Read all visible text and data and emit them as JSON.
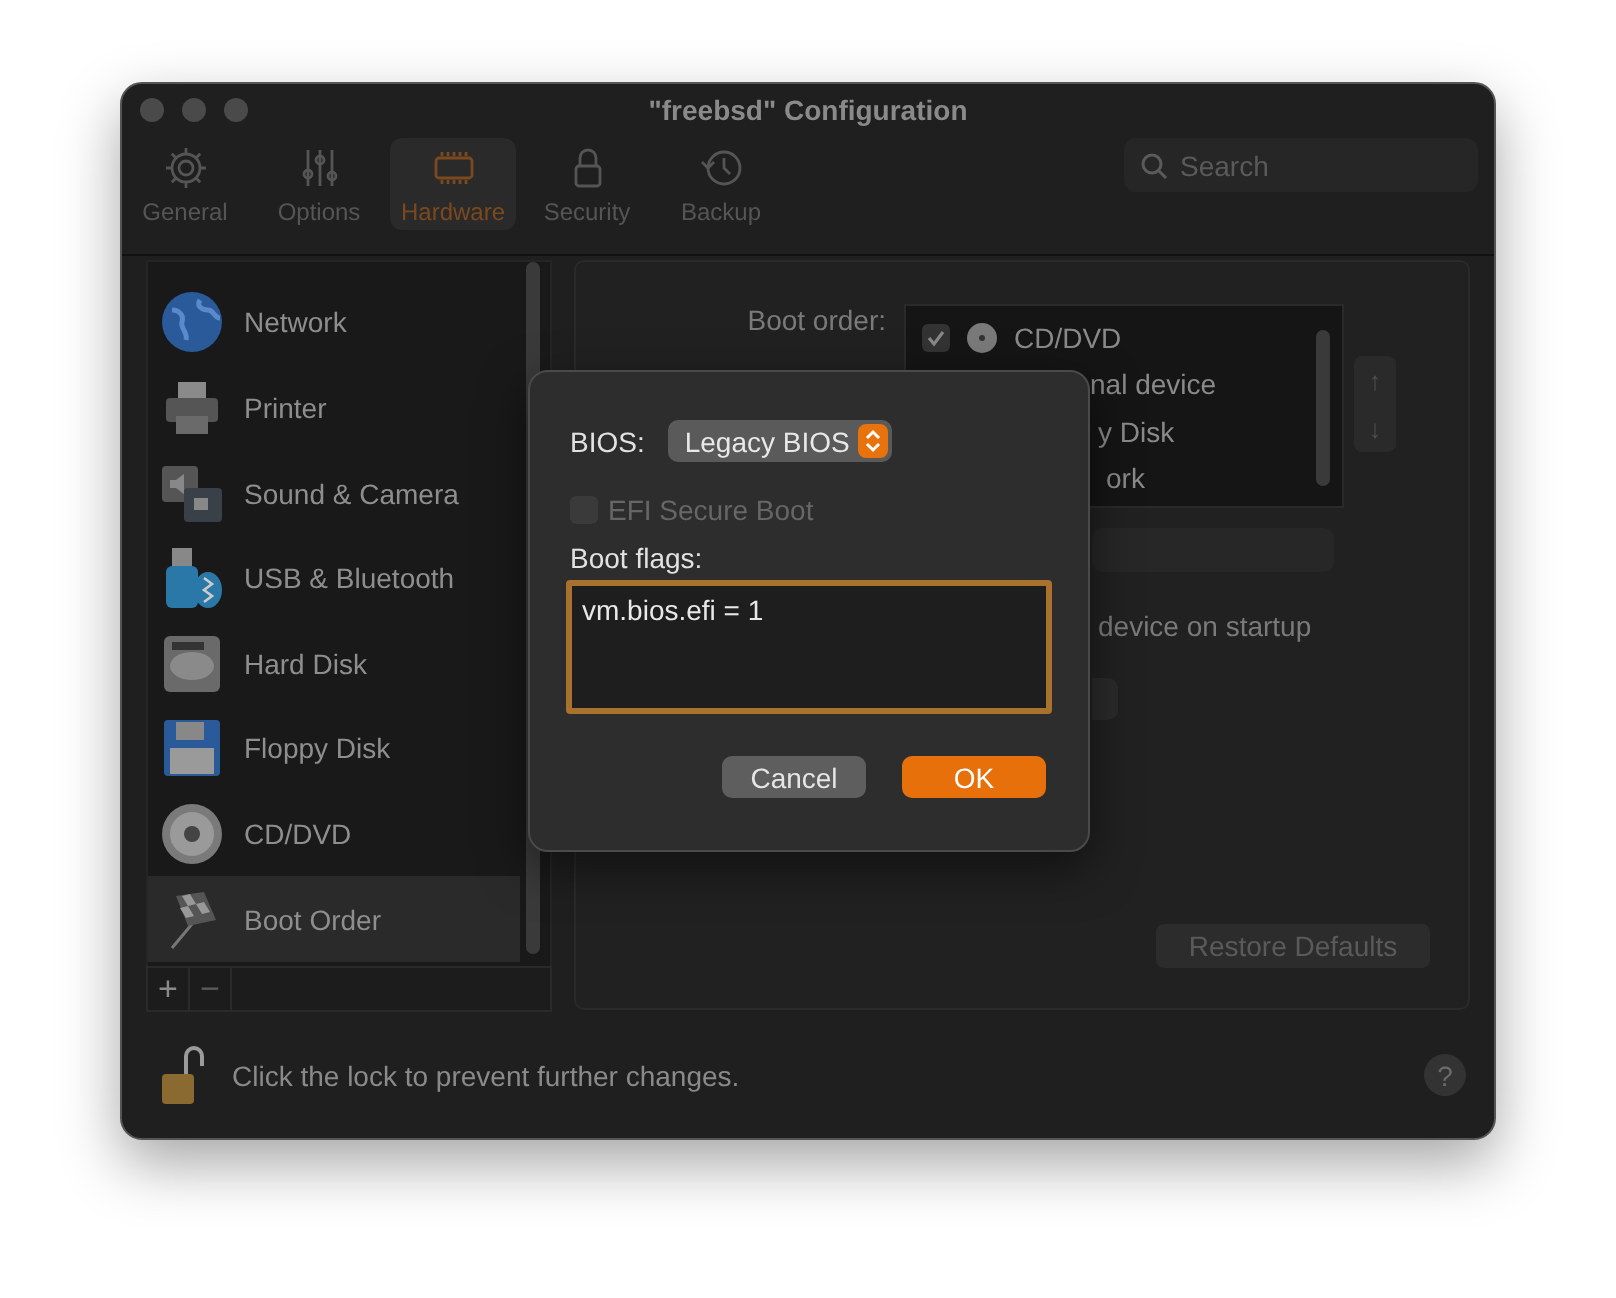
{
  "window": {
    "title": "\"freebsd\" Configuration"
  },
  "toolbar": {
    "tabs": [
      {
        "label": "General",
        "selected": false
      },
      {
        "label": "Options",
        "selected": false
      },
      {
        "label": "Hardware",
        "selected": true
      },
      {
        "label": "Security",
        "selected": false
      },
      {
        "label": "Backup",
        "selected": false
      }
    ],
    "search": {
      "placeholder": "Search"
    }
  },
  "sidebar": {
    "items": [
      {
        "label": "Network",
        "selected": false
      },
      {
        "label": "Printer",
        "selected": false
      },
      {
        "label": "Sound & Camera",
        "selected": false
      },
      {
        "label": "USB & Bluetooth",
        "selected": false
      },
      {
        "label": "Hard Disk",
        "selected": false
      },
      {
        "label": "Floppy Disk",
        "selected": false
      },
      {
        "label": "CD/DVD",
        "selected": false
      },
      {
        "label": "Boot Order",
        "selected": true
      }
    ],
    "add": "+",
    "remove": "−"
  },
  "boot_order": {
    "label": "Boot order:",
    "devices": [
      {
        "label": "CD/DVD",
        "checked": true
      },
      {
        "label": "nal device"
      },
      {
        "label": "y Disk"
      },
      {
        "label": "ork"
      }
    ],
    "move_up": "↑",
    "move_down": "↓",
    "startup_option": "device on startup",
    "restore_button": "Restore Defaults"
  },
  "status_bar": {
    "text": "Click the lock to prevent further changes.",
    "help": "?"
  },
  "sheet": {
    "bios_label": "BIOS:",
    "bios_value": "Legacy BIOS",
    "secure_boot": {
      "label": "EFI Secure Boot",
      "checked": false,
      "disabled": true
    },
    "flags_label": "Boot flags:",
    "flags_value": "vm.bios.efi = 1",
    "buttons": [
      {
        "label": "Cancel",
        "kind": "secondary"
      },
      {
        "label": "OK",
        "kind": "default"
      }
    ]
  }
}
